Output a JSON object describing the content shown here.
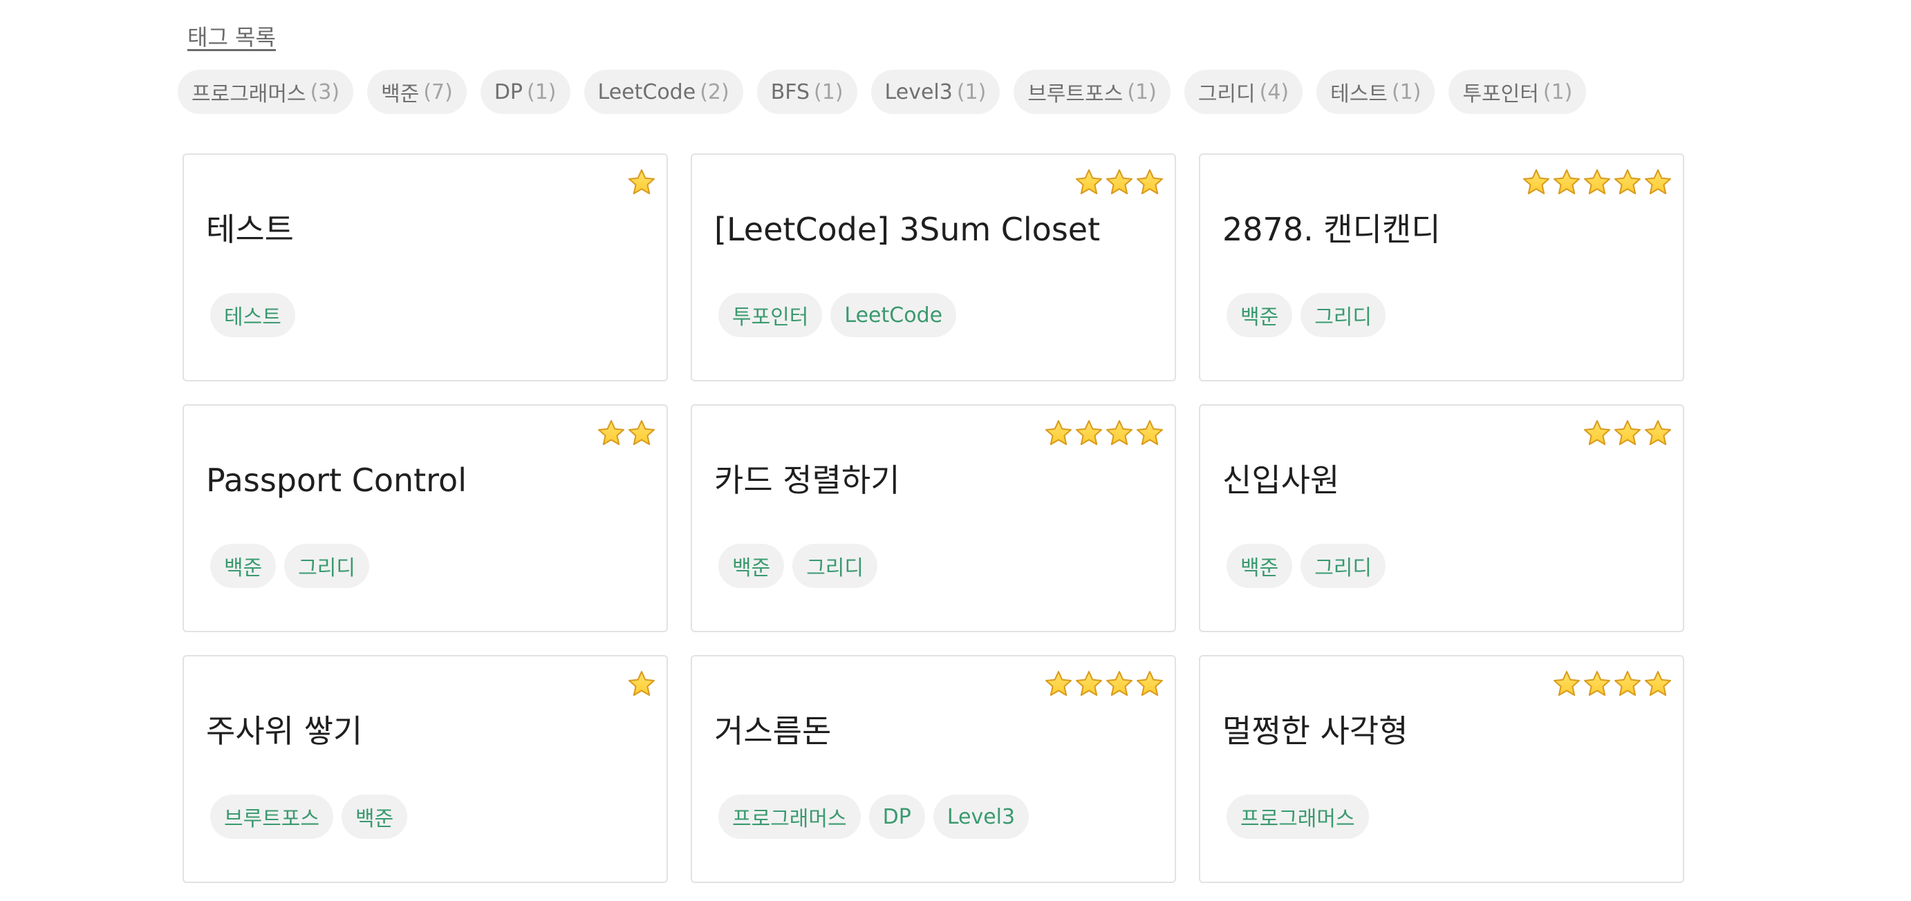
{
  "header": {
    "title": "태그 목록"
  },
  "tags": [
    {
      "name": "프로그래머스",
      "count": "(3)"
    },
    {
      "name": "백준",
      "count": "(7)"
    },
    {
      "name": "DP",
      "count": "(1)"
    },
    {
      "name": "LeetCode",
      "count": "(2)"
    },
    {
      "name": "BFS",
      "count": "(1)"
    },
    {
      "name": "Level3",
      "count": "(1)"
    },
    {
      "name": "브루트포스",
      "count": "(1)"
    },
    {
      "name": "그리디",
      "count": "(4)"
    },
    {
      "name": "테스트",
      "count": "(1)"
    },
    {
      "name": "투포인터",
      "count": "(1)"
    }
  ],
  "cards": [
    {
      "title": "테스트",
      "stars": 1,
      "tags": [
        "테스트"
      ]
    },
    {
      "title": "[LeetCode] 3Sum Closet",
      "stars": 3,
      "tags": [
        "투포인터",
        "LeetCode"
      ]
    },
    {
      "title": "2878. 캔디캔디",
      "stars": 5,
      "tags": [
        "백준",
        "그리디"
      ]
    },
    {
      "title": "Passport Control",
      "stars": 2,
      "tags": [
        "백준",
        "그리디"
      ]
    },
    {
      "title": "카드 정렬하기",
      "stars": 4,
      "tags": [
        "백준",
        "그리디"
      ]
    },
    {
      "title": "신입사원",
      "stars": 3,
      "tags": [
        "백준",
        "그리디"
      ]
    },
    {
      "title": "주사위 쌓기",
      "stars": 1,
      "tags": [
        "브루트포스",
        "백준"
      ]
    },
    {
      "title": "거스름돈",
      "stars": 4,
      "tags": [
        "프로그래머스",
        "DP",
        "Level3"
      ]
    },
    {
      "title": "멀쩡한 사각형",
      "stars": 4,
      "tags": [
        "프로그래머스"
      ]
    }
  ],
  "colors": {
    "star_fill": "#ffcc33",
    "star_stroke": "#d99a1c",
    "tag_text": "#3a9a6e",
    "chip_bg": "#f1f1f2"
  },
  "icons": {
    "star": "star-icon"
  }
}
